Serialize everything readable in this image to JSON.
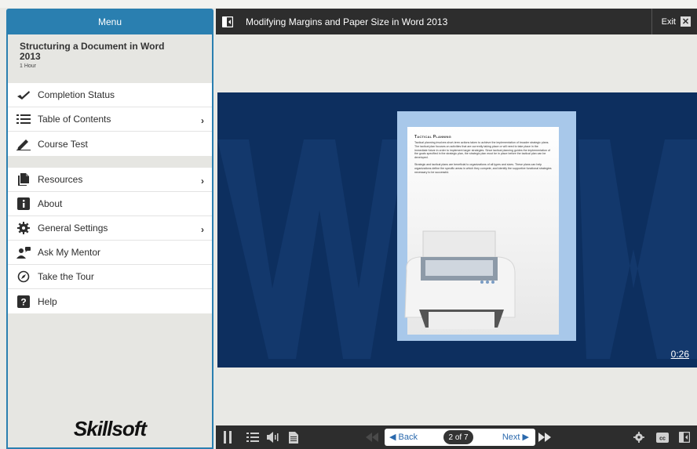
{
  "sidebar": {
    "menu_label": "Menu",
    "course_title": "Structuring a Document in Word 2013",
    "course_duration": "1 Hour",
    "groups": [
      [
        {
          "label": "Completion Status",
          "icon": "check-icon",
          "chevron": false
        },
        {
          "label": "Table of Contents",
          "icon": "list-icon",
          "chevron": true
        },
        {
          "label": "Course Test",
          "icon": "pencil-icon",
          "chevron": false
        }
      ],
      [
        {
          "label": "Resources",
          "icon": "documents-icon",
          "chevron": true
        },
        {
          "label": "About",
          "icon": "info-icon",
          "chevron": false
        },
        {
          "label": "General Settings",
          "icon": "gear-icon",
          "chevron": true
        },
        {
          "label": "Ask My Mentor",
          "icon": "mentor-icon",
          "chevron": false
        },
        {
          "label": "Take the Tour",
          "icon": "compass-icon",
          "chevron": false
        },
        {
          "label": "Help",
          "icon": "help-icon",
          "chevron": false
        }
      ]
    ],
    "chevron_glyph": "›",
    "logo_text": "Skillsoft"
  },
  "titlebar": {
    "title": "Modifying Margins and Paper Size in Word 2013",
    "exit_label": "Exit"
  },
  "video": {
    "timer": "0:26",
    "slide_heading": "Tactical Planning",
    "slide_paragraphs": [
      "Tactical planning involves short-term actions taken to achieve the implementation of broader strategic plans. The tactical plan focuses on activities that are currently taking place or will need to take place in the immediate future in order to implement larger strategies. Since tactical planning guides the implementation of the goals specified in the strategic plan, the strategic plan must be in place before the tactical plan can be developed.",
      "Strategic and tactical plans are beneficial to organizations of all types and sizes. These plans can help organizations define the specific areas in which they compete, and identify the supportive functional strategies necessary to be successful."
    ]
  },
  "controls": {
    "back_label": "◀ Back",
    "page_indicator": "2 of 7",
    "next_label": "Next ▶"
  },
  "colors": {
    "accent": "#2a7fb0",
    "bar": "#2d2d2d",
    "video_bg": "#0d2f5f",
    "link": "#2a69ad"
  }
}
